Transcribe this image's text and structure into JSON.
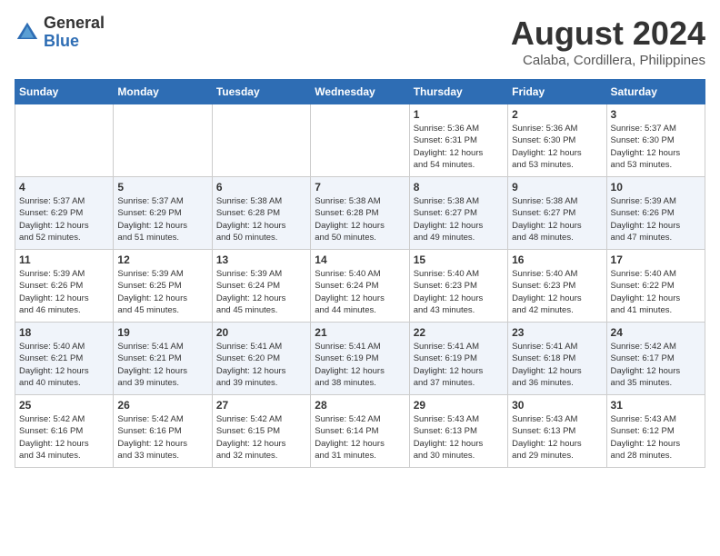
{
  "header": {
    "logo_general": "General",
    "logo_blue": "Blue",
    "month_title": "August 2024",
    "location": "Calaba, Cordillera, Philippines"
  },
  "days_of_week": [
    "Sunday",
    "Monday",
    "Tuesday",
    "Wednesday",
    "Thursday",
    "Friday",
    "Saturday"
  ],
  "weeks": [
    [
      {
        "day": "",
        "info": ""
      },
      {
        "day": "",
        "info": ""
      },
      {
        "day": "",
        "info": ""
      },
      {
        "day": "",
        "info": ""
      },
      {
        "day": "1",
        "info": "Sunrise: 5:36 AM\nSunset: 6:31 PM\nDaylight: 12 hours\nand 54 minutes."
      },
      {
        "day": "2",
        "info": "Sunrise: 5:36 AM\nSunset: 6:30 PM\nDaylight: 12 hours\nand 53 minutes."
      },
      {
        "day": "3",
        "info": "Sunrise: 5:37 AM\nSunset: 6:30 PM\nDaylight: 12 hours\nand 53 minutes."
      }
    ],
    [
      {
        "day": "4",
        "info": "Sunrise: 5:37 AM\nSunset: 6:29 PM\nDaylight: 12 hours\nand 52 minutes."
      },
      {
        "day": "5",
        "info": "Sunrise: 5:37 AM\nSunset: 6:29 PM\nDaylight: 12 hours\nand 51 minutes."
      },
      {
        "day": "6",
        "info": "Sunrise: 5:38 AM\nSunset: 6:28 PM\nDaylight: 12 hours\nand 50 minutes."
      },
      {
        "day": "7",
        "info": "Sunrise: 5:38 AM\nSunset: 6:28 PM\nDaylight: 12 hours\nand 50 minutes."
      },
      {
        "day": "8",
        "info": "Sunrise: 5:38 AM\nSunset: 6:27 PM\nDaylight: 12 hours\nand 49 minutes."
      },
      {
        "day": "9",
        "info": "Sunrise: 5:38 AM\nSunset: 6:27 PM\nDaylight: 12 hours\nand 48 minutes."
      },
      {
        "day": "10",
        "info": "Sunrise: 5:39 AM\nSunset: 6:26 PM\nDaylight: 12 hours\nand 47 minutes."
      }
    ],
    [
      {
        "day": "11",
        "info": "Sunrise: 5:39 AM\nSunset: 6:26 PM\nDaylight: 12 hours\nand 46 minutes."
      },
      {
        "day": "12",
        "info": "Sunrise: 5:39 AM\nSunset: 6:25 PM\nDaylight: 12 hours\nand 45 minutes."
      },
      {
        "day": "13",
        "info": "Sunrise: 5:39 AM\nSunset: 6:24 PM\nDaylight: 12 hours\nand 45 minutes."
      },
      {
        "day": "14",
        "info": "Sunrise: 5:40 AM\nSunset: 6:24 PM\nDaylight: 12 hours\nand 44 minutes."
      },
      {
        "day": "15",
        "info": "Sunrise: 5:40 AM\nSunset: 6:23 PM\nDaylight: 12 hours\nand 43 minutes."
      },
      {
        "day": "16",
        "info": "Sunrise: 5:40 AM\nSunset: 6:23 PM\nDaylight: 12 hours\nand 42 minutes."
      },
      {
        "day": "17",
        "info": "Sunrise: 5:40 AM\nSunset: 6:22 PM\nDaylight: 12 hours\nand 41 minutes."
      }
    ],
    [
      {
        "day": "18",
        "info": "Sunrise: 5:40 AM\nSunset: 6:21 PM\nDaylight: 12 hours\nand 40 minutes."
      },
      {
        "day": "19",
        "info": "Sunrise: 5:41 AM\nSunset: 6:21 PM\nDaylight: 12 hours\nand 39 minutes."
      },
      {
        "day": "20",
        "info": "Sunrise: 5:41 AM\nSunset: 6:20 PM\nDaylight: 12 hours\nand 39 minutes."
      },
      {
        "day": "21",
        "info": "Sunrise: 5:41 AM\nSunset: 6:19 PM\nDaylight: 12 hours\nand 38 minutes."
      },
      {
        "day": "22",
        "info": "Sunrise: 5:41 AM\nSunset: 6:19 PM\nDaylight: 12 hours\nand 37 minutes."
      },
      {
        "day": "23",
        "info": "Sunrise: 5:41 AM\nSunset: 6:18 PM\nDaylight: 12 hours\nand 36 minutes."
      },
      {
        "day": "24",
        "info": "Sunrise: 5:42 AM\nSunset: 6:17 PM\nDaylight: 12 hours\nand 35 minutes."
      }
    ],
    [
      {
        "day": "25",
        "info": "Sunrise: 5:42 AM\nSunset: 6:16 PM\nDaylight: 12 hours\nand 34 minutes."
      },
      {
        "day": "26",
        "info": "Sunrise: 5:42 AM\nSunset: 6:16 PM\nDaylight: 12 hours\nand 33 minutes."
      },
      {
        "day": "27",
        "info": "Sunrise: 5:42 AM\nSunset: 6:15 PM\nDaylight: 12 hours\nand 32 minutes."
      },
      {
        "day": "28",
        "info": "Sunrise: 5:42 AM\nSunset: 6:14 PM\nDaylight: 12 hours\nand 31 minutes."
      },
      {
        "day": "29",
        "info": "Sunrise: 5:43 AM\nSunset: 6:13 PM\nDaylight: 12 hours\nand 30 minutes."
      },
      {
        "day": "30",
        "info": "Sunrise: 5:43 AM\nSunset: 6:13 PM\nDaylight: 12 hours\nand 29 minutes."
      },
      {
        "day": "31",
        "info": "Sunrise: 5:43 AM\nSunset: 6:12 PM\nDaylight: 12 hours\nand 28 minutes."
      }
    ]
  ]
}
